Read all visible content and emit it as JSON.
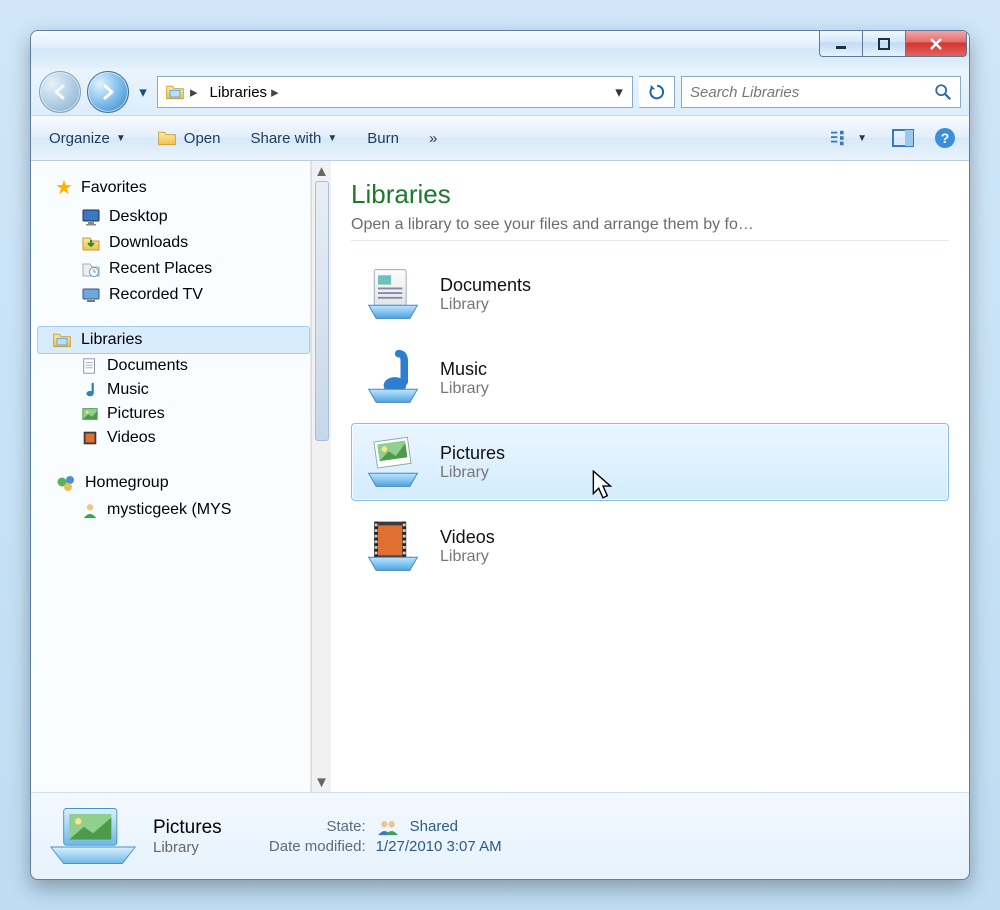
{
  "breadcrumb": {
    "root_icon": "libraries-icon",
    "seg1": "Libraries"
  },
  "search": {
    "placeholder": "Search Libraries"
  },
  "toolbar": {
    "organize": "Organize",
    "open": "Open",
    "share": "Share with",
    "burn": "Burn",
    "overflow": "»"
  },
  "nav": {
    "favorites": {
      "label": "Favorites",
      "items": [
        "Desktop",
        "Downloads",
        "Recent Places",
        "Recorded TV"
      ]
    },
    "libraries": {
      "label": "Libraries",
      "items": [
        "Documents",
        "Music",
        "Pictures",
        "Videos"
      ]
    },
    "homegroup": {
      "label": "Homegroup",
      "items": [
        "mysticgeek (MYS"
      ]
    }
  },
  "content": {
    "title": "Libraries",
    "subtitle": "Open a library to see your files and arrange them by fo…",
    "items": [
      {
        "name": "Documents",
        "type": "Library",
        "icon": "documents"
      },
      {
        "name": "Music",
        "type": "Library",
        "icon": "music"
      },
      {
        "name": "Pictures",
        "type": "Library",
        "icon": "pictures",
        "selected": true
      },
      {
        "name": "Videos",
        "type": "Library",
        "icon": "videos"
      }
    ]
  },
  "details": {
    "name": "Pictures",
    "type": "Library",
    "state_label": "State:",
    "state_value": "Shared",
    "modified_label": "Date modified:",
    "modified_value": "1/27/2010 3:07 AM"
  }
}
